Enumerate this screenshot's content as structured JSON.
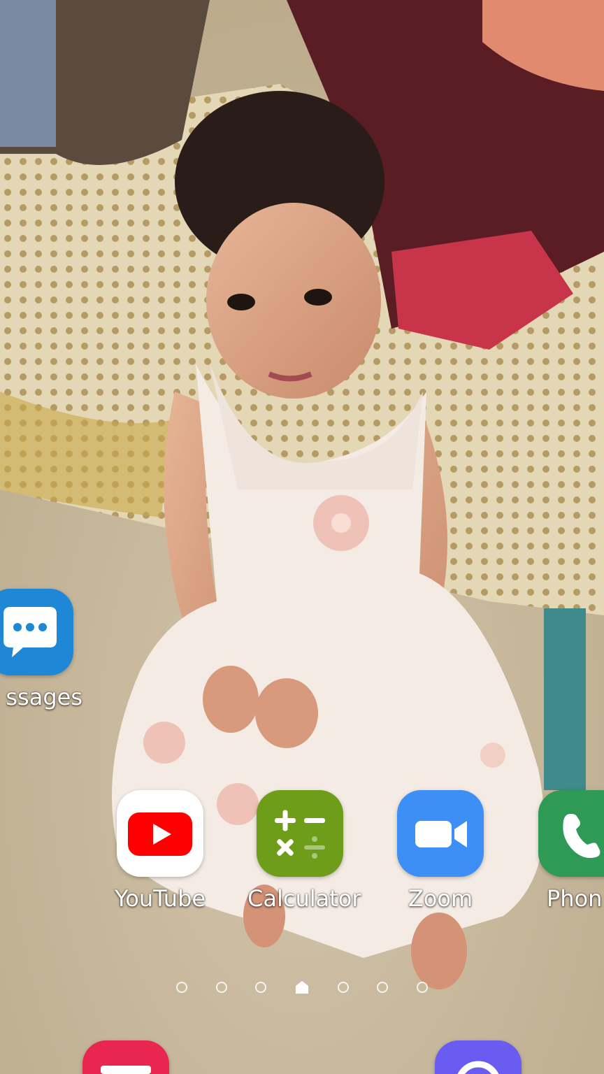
{
  "home_screen": {
    "apps": {
      "messages": {
        "label": "ssages",
        "icon": "message-bubble-icon",
        "color": "#1e88d6"
      },
      "youtube": {
        "label": "YouTube",
        "icon": "play-icon",
        "color": "#ff0000"
      },
      "calculator": {
        "label": "Calculator",
        "icon": "calculator-icon",
        "color": "#6e9d1a"
      },
      "zoom": {
        "label": "Zoom",
        "icon": "video-camera-icon",
        "color": "#3d8ef5"
      },
      "phone": {
        "label": "Phon",
        "icon": "phone-icon",
        "color": "#2f9a55"
      }
    },
    "pager": {
      "pages": 7,
      "current_index": 3,
      "current_icon": "home-icon"
    },
    "dock": {
      "left_icon": {
        "icon": "app-icon",
        "color": "#e8264f"
      },
      "right_icon": {
        "icon": "app-icon",
        "color": "#6a5cf0"
      }
    }
  }
}
